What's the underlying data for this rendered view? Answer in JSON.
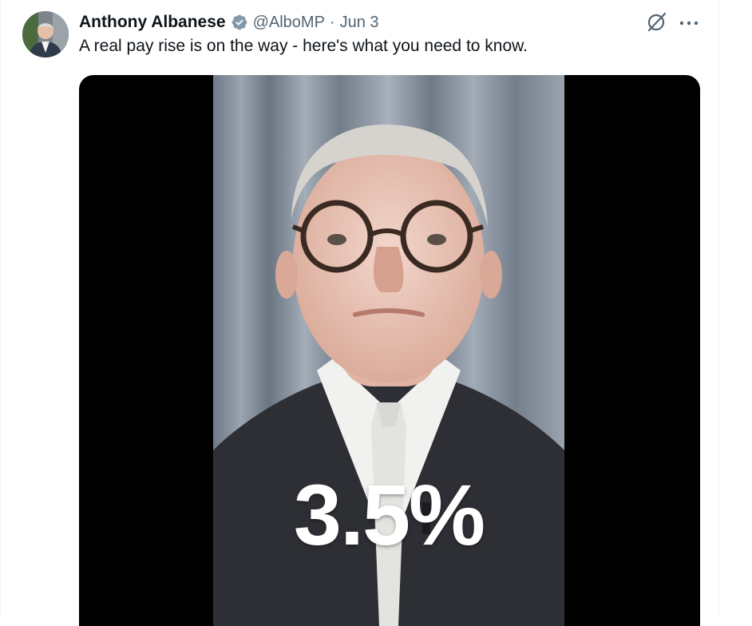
{
  "tweet": {
    "author_name": "Anthony Albanese",
    "handle": "@AlboMP",
    "separator": "·",
    "date": "Jun 3",
    "text": "A real pay rise is on the way - here's what you need to know.",
    "verified_badge_icon": "verified-badge-icon",
    "grok_icon": "grok-icon",
    "more_icon": "more-options-icon"
  },
  "media": {
    "overlay_text": "3.5%"
  },
  "colors": {
    "text_primary": "#0f1419",
    "text_secondary": "#536471",
    "verified_badge": "#829aab",
    "media_background": "#000000"
  }
}
